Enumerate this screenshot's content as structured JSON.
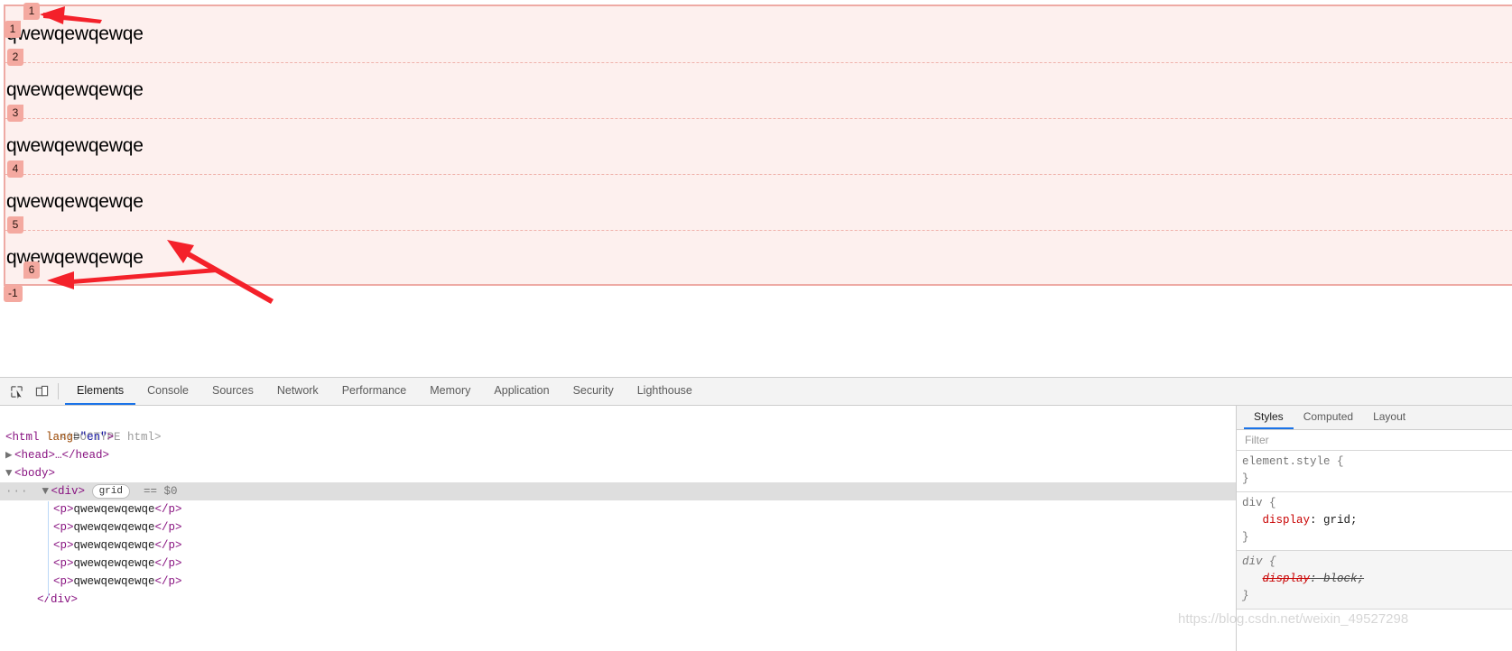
{
  "page": {
    "paragraphs": [
      "qwewqewqewqe",
      "qwewqewqewqe",
      "qwewqewqewqe",
      "qwewqewqewqe",
      "qwewqewqewqe"
    ],
    "grid_overlay": {
      "column_badges": [
        "1"
      ],
      "row_badges": [
        "1",
        "2",
        "3",
        "4",
        "5",
        "6"
      ],
      "negative_badge": "-1",
      "overlay_color": "#f4a9a0",
      "overlay_fill": "#fdf0ee",
      "annotation_arrow_color": "#f4212a"
    }
  },
  "devtools": {
    "toolbar": {
      "inspect_icon": "inspect-element-icon",
      "device_icon": "device-toolbar-icon",
      "tabs": [
        {
          "label": "Elements",
          "active": true
        },
        {
          "label": "Console",
          "active": false
        },
        {
          "label": "Sources",
          "active": false
        },
        {
          "label": "Network",
          "active": false
        },
        {
          "label": "Performance",
          "active": false
        },
        {
          "label": "Memory",
          "active": false
        },
        {
          "label": "Application",
          "active": false
        },
        {
          "label": "Security",
          "active": false
        },
        {
          "label": "Lighthouse",
          "active": false
        }
      ]
    },
    "dom_tree": {
      "doctype": "<!DOCTYPE html>",
      "html_open_tag": "<html",
      "html_attr_name": "lang",
      "html_attr_value": "\"en\"",
      "html_close_bracket": ">",
      "head_line": "<head>…</head>",
      "body_line": "<body>",
      "div_tag": "<div>",
      "div_badge": "grid",
      "div_selected_marker": "== $0",
      "ellipsis": "···",
      "p_open": "<p>",
      "p_text": "qwewqewqewqe",
      "p_close": "</p>",
      "div_close": "</div>"
    },
    "styles_panel": {
      "tabs": [
        {
          "label": "Styles",
          "active": true
        },
        {
          "label": "Computed",
          "active": false
        },
        {
          "label": "Layout",
          "active": false
        }
      ],
      "filter_placeholder": "Filter",
      "filter_value": "",
      "rules": [
        {
          "selector": "element.style",
          "open_brace": "{",
          "close_brace": "}",
          "declarations": [],
          "user_agent": false
        },
        {
          "selector": "div",
          "open_brace": "{",
          "close_brace": "}",
          "declarations": [
            {
              "property": "display",
              "value": "grid;",
              "struck": false
            }
          ],
          "user_agent": false
        },
        {
          "selector": "div",
          "open_brace": "{",
          "close_brace": "}",
          "declarations": [
            {
              "property": "display",
              "value": "block;",
              "struck": true
            }
          ],
          "user_agent": true
        }
      ]
    }
  },
  "watermark": {
    "text": "https://blog.csdn.net/weixin_49527298"
  }
}
